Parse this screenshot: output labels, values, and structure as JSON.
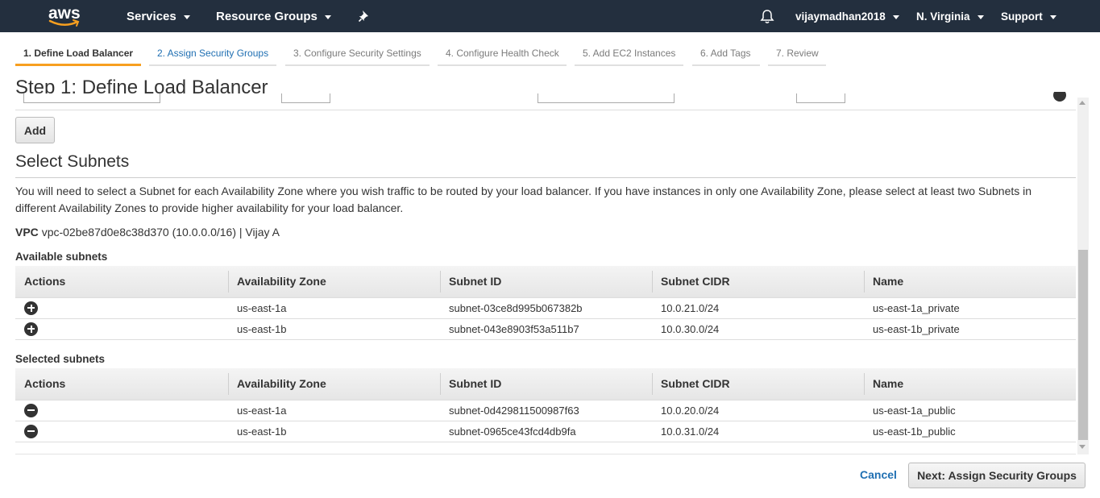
{
  "topnav": {
    "logo_text": "aws",
    "services": "Services",
    "resource_groups": "Resource Groups",
    "user": "vijaymadhan2018",
    "region": "N. Virginia",
    "support": "Support"
  },
  "wizard_tabs": [
    {
      "label": "1. Define Load Balancer"
    },
    {
      "label": "2. Assign Security Groups"
    },
    {
      "label": "3. Configure Security Settings"
    },
    {
      "label": "4. Configure Health Check"
    },
    {
      "label": "5. Add EC2 Instances"
    },
    {
      "label": "6. Add Tags"
    },
    {
      "label": "7. Review"
    }
  ],
  "page_title": "Step 1: Define Load Balancer",
  "add_button": "Add",
  "subnets": {
    "title": "Select Subnets",
    "description": "You will need to select a Subnet for each Availability Zone where you wish traffic to be routed by your load balancer. If you have instances in only one Availability Zone, please select at least two Subnets in different Availability Zones to provide higher availability for your load balancer.",
    "vpc_label": "VPC",
    "vpc_value": "vpc-02be87d0e8c38d370 (10.0.0.0/16) | Vijay A",
    "available_label": "Available subnets",
    "selected_label": "Selected subnets",
    "columns": [
      "Actions",
      "Availability Zone",
      "Subnet ID",
      "Subnet CIDR",
      "Name"
    ],
    "available": [
      {
        "az": "us-east-1a",
        "id": "subnet-03ce8d995b067382b",
        "cidr": "10.0.21.0/24",
        "name": "us-east-1a_private"
      },
      {
        "az": "us-east-1b",
        "id": "subnet-043e8903f53a511b7",
        "cidr": "10.0.30.0/24",
        "name": "us-east-1b_private"
      }
    ],
    "selected": [
      {
        "az": "us-east-1a",
        "id": "subnet-0d429811500987f63",
        "cidr": "10.0.20.0/24",
        "name": "us-east-1a_public"
      },
      {
        "az": "us-east-1b",
        "id": "subnet-0965ce43fcd4db9fa",
        "cidr": "10.0.31.0/24",
        "name": "us-east-1b_public"
      }
    ]
  },
  "footer": {
    "cancel": "Cancel",
    "next": "Next: Assign Security Groups"
  },
  "colors": {
    "nav_bg": "#232f3e",
    "active_tab_accent": "#f79f1f",
    "link": "#1f6fb2"
  }
}
